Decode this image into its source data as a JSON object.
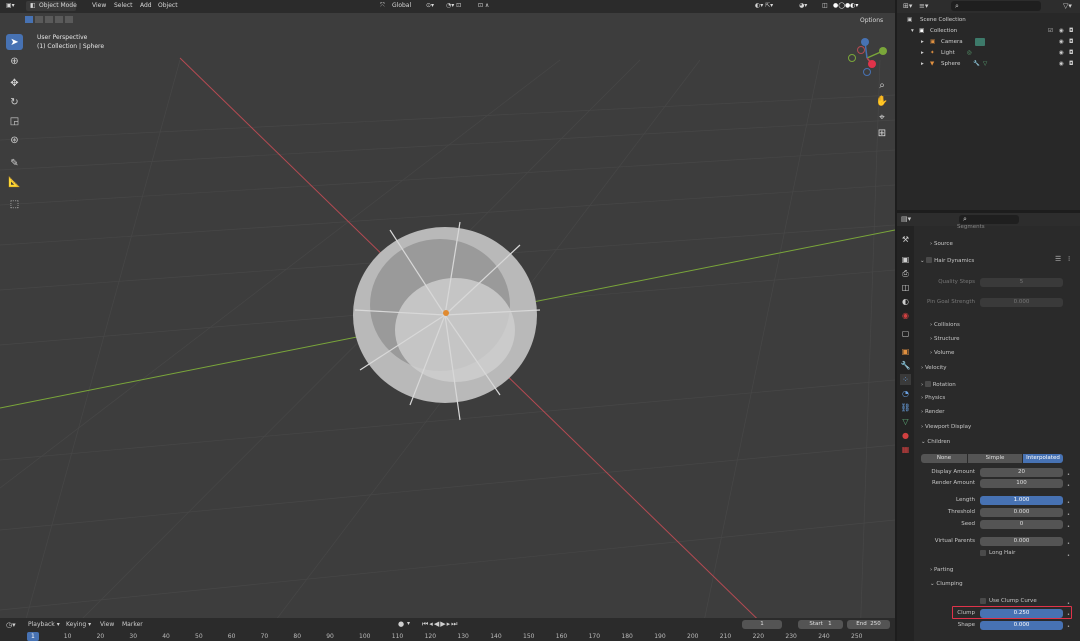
{
  "header": {
    "mode": "Object Mode",
    "menus": [
      "View",
      "Select",
      "Add",
      "Object"
    ],
    "transform_orientation": "Global",
    "options": "Options"
  },
  "viewport": {
    "view_name": "User Perspective",
    "object_path": "(1) Collection | Sphere"
  },
  "outliner": {
    "scene_collection": "Scene Collection",
    "collection": "Collection",
    "items": [
      "Camera",
      "Light",
      "Sphere"
    ]
  },
  "properties": {
    "top_field": "Segments",
    "source": "Source",
    "hair_dynamics": "Hair Dynamics",
    "quality_steps_label": "Quality Steps",
    "quality_steps_value": "5",
    "pin_goal_label": "Pin Goal Strength",
    "pin_goal_value": "0.000",
    "collisions": "Collisions",
    "structure": "Structure",
    "volume": "Volume",
    "velocity": "Velocity",
    "rotation": "Rotation",
    "physics": "Physics",
    "render": "Render",
    "viewport_display": "Viewport Display",
    "children": "Children",
    "child_modes": [
      "None",
      "Simple",
      "Interpolated"
    ],
    "display_amount_label": "Display Amount",
    "display_amount": "20",
    "render_amount_label": "Render Amount",
    "render_amount": "100",
    "length_label": "Length",
    "length": "1.000",
    "threshold_label": "Threshold",
    "threshold": "0.000",
    "seed_label": "Seed",
    "seed": "0",
    "virtual_parents_label": "Virtual Parents",
    "virtual_parents": "0.000",
    "long_hair": "Long Hair",
    "parting": "Parting",
    "clumping": "Clumping",
    "use_clump_curve": "Use Clump Curve",
    "clump_label": "Clump",
    "clump": "0.250",
    "shape_label": "Shape",
    "shape": "0.000"
  },
  "timeline": {
    "menus": [
      "Playback",
      "Keying",
      "View",
      "Marker"
    ],
    "current_frame": "1",
    "start_label": "Start",
    "start": "1",
    "end_label": "End",
    "end": "250",
    "ticks": [
      "1",
      "10",
      "20",
      "30",
      "40",
      "50",
      "60",
      "70",
      "80",
      "90",
      "100",
      "110",
      "120",
      "130",
      "140",
      "150",
      "160",
      "170",
      "180",
      "190",
      "200",
      "210",
      "220",
      "230",
      "240",
      "250"
    ]
  },
  "colors": {
    "accent": "#4772b3",
    "highlight_box": "#e0334a",
    "x_axis": "#b54a52",
    "y_axis": "#7aa63a"
  }
}
